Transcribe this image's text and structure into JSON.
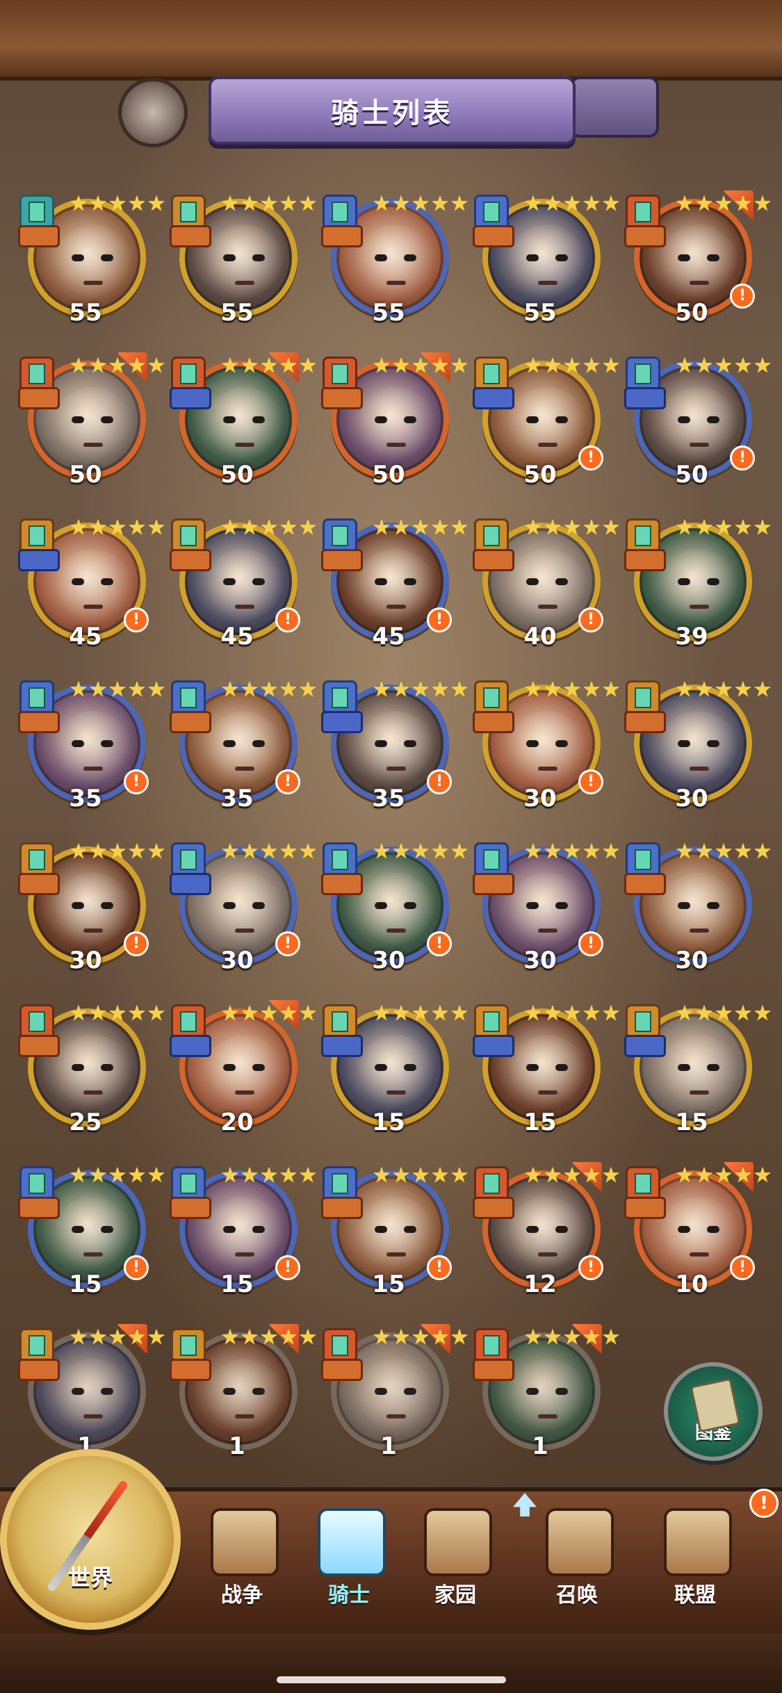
{
  "page_title": "骑士列表",
  "knights": [
    {
      "level": "55",
      "stars": 5,
      "rim": "gold",
      "alert": false,
      "class_color": "green",
      "role": "orange",
      "corner": false
    },
    {
      "level": "55",
      "stars": 5,
      "rim": "gold",
      "alert": false,
      "class_color": "orange",
      "role": "orange",
      "corner": false
    },
    {
      "level": "55",
      "stars": 5,
      "rim": "blue",
      "alert": false,
      "class_color": "blue",
      "role": "orange",
      "corner": false
    },
    {
      "level": "55",
      "stars": 5,
      "rim": "gold",
      "alert": false,
      "class_color": "blue",
      "role": "orange",
      "corner": false
    },
    {
      "level": "50",
      "stars": 5,
      "rim": "red",
      "alert": true,
      "class_color": "red",
      "role": "orange",
      "corner": true
    },
    {
      "level": "50",
      "stars": 5,
      "rim": "red",
      "alert": false,
      "class_color": "red",
      "role": "orange",
      "corner": true
    },
    {
      "level": "50",
      "stars": 5,
      "rim": "red",
      "alert": false,
      "class_color": "red",
      "role": "blue",
      "corner": true
    },
    {
      "level": "50",
      "stars": 5,
      "rim": "red",
      "alert": false,
      "class_color": "red",
      "role": "orange",
      "corner": true
    },
    {
      "level": "50",
      "stars": 5,
      "rim": "gold",
      "alert": true,
      "class_color": "orange",
      "role": "blue",
      "corner": false
    },
    {
      "level": "50",
      "stars": 5,
      "rim": "blue",
      "alert": true,
      "class_color": "blue",
      "role": "blue",
      "corner": false
    },
    {
      "level": "45",
      "stars": 5,
      "rim": "gold",
      "alert": true,
      "class_color": "orange",
      "role": "blue",
      "corner": false
    },
    {
      "level": "45",
      "stars": 5,
      "rim": "gold",
      "alert": true,
      "class_color": "orange",
      "role": "orange",
      "corner": false
    },
    {
      "level": "45",
      "stars": 5,
      "rim": "blue",
      "alert": true,
      "class_color": "blue",
      "role": "orange",
      "corner": false
    },
    {
      "level": "40",
      "stars": 5,
      "rim": "gold",
      "alert": true,
      "class_color": "orange",
      "role": "orange",
      "corner": false
    },
    {
      "level": "39",
      "stars": 5,
      "rim": "gold",
      "alert": false,
      "class_color": "orange",
      "role": "orange",
      "corner": false
    },
    {
      "level": "35",
      "stars": 5,
      "rim": "blue",
      "alert": true,
      "class_color": "blue",
      "role": "orange",
      "corner": false
    },
    {
      "level": "35",
      "stars": 5,
      "rim": "blue",
      "alert": true,
      "class_color": "blue",
      "role": "orange",
      "corner": false
    },
    {
      "level": "35",
      "stars": 5,
      "rim": "blue",
      "alert": true,
      "class_color": "blue",
      "role": "blue",
      "corner": false
    },
    {
      "level": "30",
      "stars": 5,
      "rim": "gold",
      "alert": true,
      "class_color": "orange",
      "role": "orange",
      "corner": false
    },
    {
      "level": "30",
      "stars": 5,
      "rim": "gold",
      "alert": false,
      "class_color": "orange",
      "role": "orange",
      "corner": false
    },
    {
      "level": "30",
      "stars": 5,
      "rim": "gold",
      "alert": true,
      "class_color": "orange",
      "role": "orange",
      "corner": false
    },
    {
      "level": "30",
      "stars": 5,
      "rim": "blue",
      "alert": true,
      "class_color": "blue",
      "role": "blue",
      "corner": false
    },
    {
      "level": "30",
      "stars": 5,
      "rim": "blue",
      "alert": true,
      "class_color": "blue",
      "role": "orange",
      "corner": false
    },
    {
      "level": "30",
      "stars": 5,
      "rim": "blue",
      "alert": true,
      "class_color": "blue",
      "role": "orange",
      "corner": false
    },
    {
      "level": "30",
      "stars": 5,
      "rim": "blue",
      "alert": false,
      "class_color": "blue",
      "role": "orange",
      "corner": false
    },
    {
      "level": "25",
      "stars": 5,
      "rim": "gold",
      "alert": false,
      "class_color": "red",
      "role": "orange",
      "corner": false
    },
    {
      "level": "20",
      "stars": 5,
      "rim": "red",
      "alert": false,
      "class_color": "red",
      "role": "blue",
      "corner": true
    },
    {
      "level": "15",
      "stars": 5,
      "rim": "gold",
      "alert": false,
      "class_color": "orange",
      "role": "blue",
      "corner": false
    },
    {
      "level": "15",
      "stars": 5,
      "rim": "gold",
      "alert": false,
      "class_color": "orange",
      "role": "blue",
      "corner": false
    },
    {
      "level": "15",
      "stars": 5,
      "rim": "gold",
      "alert": false,
      "class_color": "orange",
      "role": "blue",
      "corner": false
    },
    {
      "level": "15",
      "stars": 5,
      "rim": "blue",
      "alert": true,
      "class_color": "blue",
      "role": "orange",
      "corner": false
    },
    {
      "level": "15",
      "stars": 5,
      "rim": "blue",
      "alert": true,
      "class_color": "blue",
      "role": "orange",
      "corner": false
    },
    {
      "level": "15",
      "stars": 5,
      "rim": "blue",
      "alert": true,
      "class_color": "blue",
      "role": "orange",
      "corner": false
    },
    {
      "level": "12",
      "stars": 5,
      "rim": "red",
      "alert": true,
      "class_color": "red",
      "role": "orange",
      "corner": true
    },
    {
      "level": "10",
      "stars": 5,
      "rim": "red",
      "alert": true,
      "class_color": "red",
      "role": "orange",
      "corner": true
    },
    {
      "level": "1",
      "stars": 5,
      "rim": "gray",
      "alert": false,
      "class_color": "orange",
      "role": "orange",
      "corner": true
    },
    {
      "level": "1",
      "stars": 5,
      "rim": "gray",
      "alert": false,
      "class_color": "orange",
      "role": "orange",
      "corner": true
    },
    {
      "level": "1",
      "stars": 5,
      "rim": "gray",
      "alert": false,
      "class_color": "red",
      "role": "orange",
      "corner": true
    },
    {
      "level": "1",
      "stars": 5,
      "rim": "gray",
      "alert": false,
      "class_color": "red",
      "role": "orange",
      "corner": true
    }
  ],
  "collection_button": {
    "label": "图鉴"
  },
  "bottom_nav": {
    "world": "世界",
    "war": "战争",
    "knight": "骑士",
    "home": "家园",
    "summon": "召唤",
    "alliance": "联盟",
    "alert": "!"
  }
}
